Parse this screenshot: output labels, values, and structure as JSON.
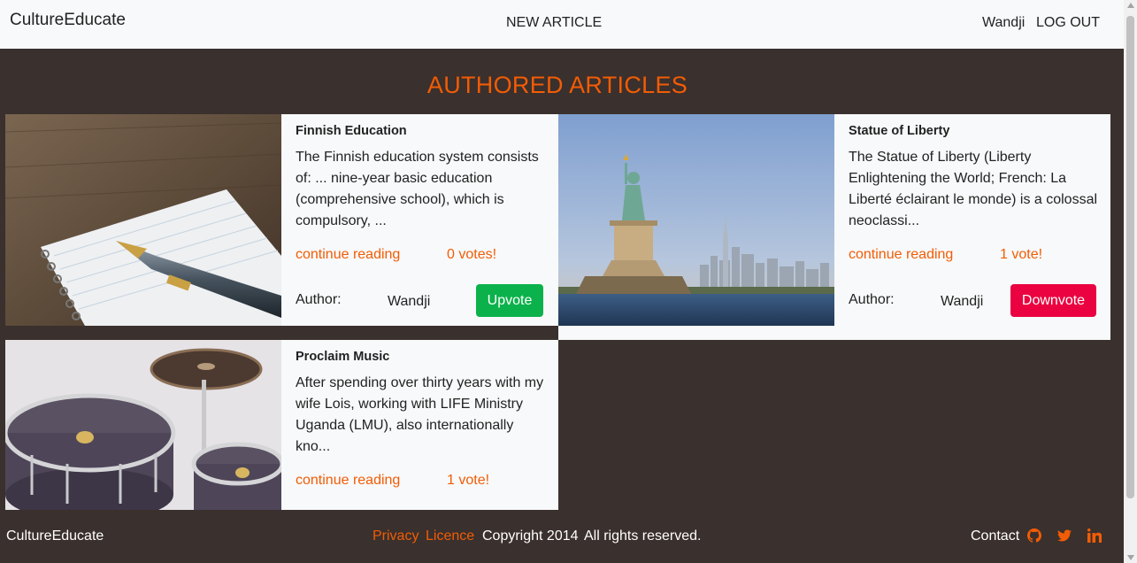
{
  "nav": {
    "brand": "CultureEducate",
    "new_article": "NEW ARTICLE",
    "user": "Wandji",
    "logout": "LOG OUT"
  },
  "section_title": "AUTHORED ARTICLES",
  "articles": [
    {
      "title": "Finnish Education",
      "excerpt": "The Finnish education system consists of: ... nine-year basic education (comprehensive school), which is compulsory, ...",
      "continue_label": "continue reading",
      "votes": "0 votes!",
      "author_label": "Author:",
      "author": "Wandji",
      "vote_button": "Upvote",
      "image_icon": "notebook-pen-image"
    },
    {
      "title": "Statue of Liberty",
      "excerpt": "The Statue of Liberty (Liberty Enlightening the World; French: La Liberté éclairant le monde) is a colossal neoclassi...",
      "continue_label": "continue reading",
      "votes": "1 vote!",
      "author_label": "Author:",
      "author": "Wandji",
      "vote_button": "Downvote",
      "image_icon": "statue-of-liberty-image"
    },
    {
      "title": "Proclaim Music",
      "excerpt": "After spending over thirty years with my wife Lois, working with LIFE Ministry Uganda (LMU), also internationally kno...",
      "continue_label": "continue reading",
      "votes": "1 vote!",
      "image_icon": "drum-kit-image"
    }
  ],
  "footer": {
    "brand": "CultureEducate",
    "privacy": "Privacy",
    "licence": "Licence",
    "copyright": "Copyright 2014",
    "rights": "All rights reserved.",
    "contact": "Contact",
    "icons": [
      "github-icon",
      "twitter-icon",
      "linkedin-icon"
    ]
  },
  "colors": {
    "accent": "#f25c05",
    "upvote": "#0bb24b",
    "downvote": "#ea0340",
    "background": "#3a302d",
    "card": "#f8f9fa"
  }
}
